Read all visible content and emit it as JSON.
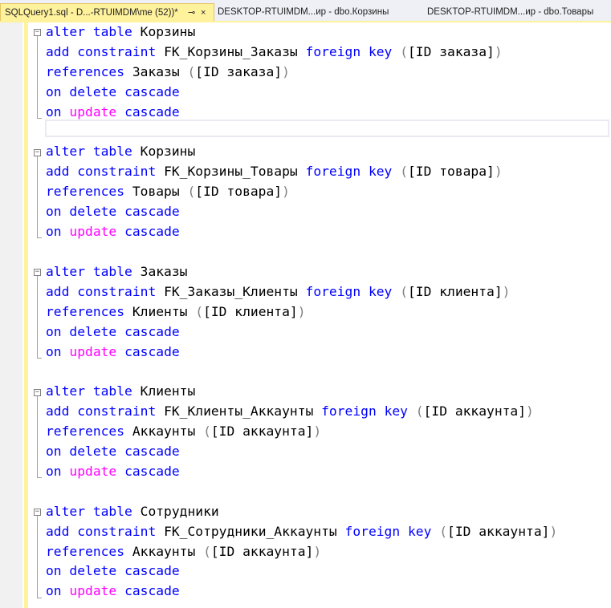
{
  "tabs": [
    {
      "label": "SQLQuery1.sql - D...-RTUIMDM\\me (52))*",
      "active": true,
      "pin_icon": "⊸",
      "close_icon": "×"
    },
    {
      "label": "DESKTOP-RTUIMDM...ир - dbo.Корзины",
      "active": false
    },
    {
      "label": "DESKTOP-RTUIMDM...ир - dbo.Товары",
      "active": false
    }
  ],
  "colors": {
    "keyword": "#0000ff",
    "function_keyword": "#ff00ff",
    "punctuation": "#808080",
    "identifier": "#000000",
    "active_tab": "#fff29d",
    "change_bar": "#fff29d"
  },
  "editor": {
    "blocks": [
      {
        "lines": [
          [
            {
              "t": "alter",
              "c": "kw"
            },
            {
              "t": " "
            },
            {
              "t": "table",
              "c": "kw"
            },
            {
              "t": " Корзины"
            }
          ],
          [
            {
              "t": "add",
              "c": "kw"
            },
            {
              "t": " "
            },
            {
              "t": "constraint",
              "c": "kw"
            },
            {
              "t": " FK_Корзины_Заказы "
            },
            {
              "t": "foreign",
              "c": "kw"
            },
            {
              "t": " "
            },
            {
              "t": "key",
              "c": "kw"
            },
            {
              "t": " "
            },
            {
              "t": "(",
              "c": "gy"
            },
            {
              "t": "[ID заказа]"
            },
            {
              "t": ")",
              "c": "gy"
            }
          ],
          [
            {
              "t": "references",
              "c": "kw"
            },
            {
              "t": " Заказы "
            },
            {
              "t": "(",
              "c": "gy"
            },
            {
              "t": "[ID заказа]"
            },
            {
              "t": ")",
              "c": "gy"
            }
          ],
          [
            {
              "t": "on",
              "c": "kw"
            },
            {
              "t": " "
            },
            {
              "t": "delete",
              "c": "kw"
            },
            {
              "t": " "
            },
            {
              "t": "cascade",
              "c": "kw"
            }
          ],
          [
            {
              "t": "on",
              "c": "kw"
            },
            {
              "t": " "
            },
            {
              "t": "update",
              "c": "pk"
            },
            {
              "t": " "
            },
            {
              "t": "cascade",
              "c": "kw"
            }
          ]
        ]
      },
      {
        "lines": [
          [
            {
              "t": "alter",
              "c": "kw"
            },
            {
              "t": " "
            },
            {
              "t": "table",
              "c": "kw"
            },
            {
              "t": " Корзины"
            }
          ],
          [
            {
              "t": "add",
              "c": "kw"
            },
            {
              "t": " "
            },
            {
              "t": "constraint",
              "c": "kw"
            },
            {
              "t": " FK_Корзины_Товары "
            },
            {
              "t": "foreign",
              "c": "kw"
            },
            {
              "t": " "
            },
            {
              "t": "key",
              "c": "kw"
            },
            {
              "t": " "
            },
            {
              "t": "(",
              "c": "gy"
            },
            {
              "t": "[ID товара]"
            },
            {
              "t": ")",
              "c": "gy"
            }
          ],
          [
            {
              "t": "references",
              "c": "kw"
            },
            {
              "t": " Товары "
            },
            {
              "t": "(",
              "c": "gy"
            },
            {
              "t": "[ID товара]"
            },
            {
              "t": ")",
              "c": "gy"
            }
          ],
          [
            {
              "t": "on",
              "c": "kw"
            },
            {
              "t": " "
            },
            {
              "t": "delete",
              "c": "kw"
            },
            {
              "t": " "
            },
            {
              "t": "cascade",
              "c": "kw"
            }
          ],
          [
            {
              "t": "on",
              "c": "kw"
            },
            {
              "t": " "
            },
            {
              "t": "update",
              "c": "pk"
            },
            {
              "t": " "
            },
            {
              "t": "cascade",
              "c": "kw"
            }
          ]
        ]
      },
      {
        "lines": [
          [
            {
              "t": "alter",
              "c": "kw"
            },
            {
              "t": " "
            },
            {
              "t": "table",
              "c": "kw"
            },
            {
              "t": " Заказы"
            }
          ],
          [
            {
              "t": "add",
              "c": "kw"
            },
            {
              "t": " "
            },
            {
              "t": "constraint",
              "c": "kw"
            },
            {
              "t": " FK_Заказы_Клиенты "
            },
            {
              "t": "foreign",
              "c": "kw"
            },
            {
              "t": " "
            },
            {
              "t": "key",
              "c": "kw"
            },
            {
              "t": " "
            },
            {
              "t": "(",
              "c": "gy"
            },
            {
              "t": "[ID клиента]"
            },
            {
              "t": ")",
              "c": "gy"
            }
          ],
          [
            {
              "t": "references",
              "c": "kw"
            },
            {
              "t": " Клиенты "
            },
            {
              "t": "(",
              "c": "gy"
            },
            {
              "t": "[ID клиента]"
            },
            {
              "t": ")",
              "c": "gy"
            }
          ],
          [
            {
              "t": "on",
              "c": "kw"
            },
            {
              "t": " "
            },
            {
              "t": "delete",
              "c": "kw"
            },
            {
              "t": " "
            },
            {
              "t": "cascade",
              "c": "kw"
            }
          ],
          [
            {
              "t": "on",
              "c": "kw"
            },
            {
              "t": " "
            },
            {
              "t": "update",
              "c": "pk"
            },
            {
              "t": " "
            },
            {
              "t": "cascade",
              "c": "kw"
            }
          ]
        ]
      },
      {
        "lines": [
          [
            {
              "t": "alter",
              "c": "kw"
            },
            {
              "t": " "
            },
            {
              "t": "table",
              "c": "kw"
            },
            {
              "t": " Клиенты"
            }
          ],
          [
            {
              "t": "add",
              "c": "kw"
            },
            {
              "t": " "
            },
            {
              "t": "constraint",
              "c": "kw"
            },
            {
              "t": " FK_Клиенты_Аккаунты "
            },
            {
              "t": "foreign",
              "c": "kw"
            },
            {
              "t": " "
            },
            {
              "t": "key",
              "c": "kw"
            },
            {
              "t": " "
            },
            {
              "t": "(",
              "c": "gy"
            },
            {
              "t": "[ID аккаунта]"
            },
            {
              "t": ")",
              "c": "gy"
            }
          ],
          [
            {
              "t": "references",
              "c": "kw"
            },
            {
              "t": " Аккаунты "
            },
            {
              "t": "(",
              "c": "gy"
            },
            {
              "t": "[ID аккаунта]"
            },
            {
              "t": ")",
              "c": "gy"
            }
          ],
          [
            {
              "t": "on",
              "c": "kw"
            },
            {
              "t": " "
            },
            {
              "t": "delete",
              "c": "kw"
            },
            {
              "t": " "
            },
            {
              "t": "cascade",
              "c": "kw"
            }
          ],
          [
            {
              "t": "on",
              "c": "kw"
            },
            {
              "t": " "
            },
            {
              "t": "update",
              "c": "pk"
            },
            {
              "t": " "
            },
            {
              "t": "cascade",
              "c": "kw"
            }
          ]
        ]
      },
      {
        "lines": [
          [
            {
              "t": "alter",
              "c": "kw"
            },
            {
              "t": " "
            },
            {
              "t": "table",
              "c": "kw"
            },
            {
              "t": " Сотрудники"
            }
          ],
          [
            {
              "t": "add",
              "c": "kw"
            },
            {
              "t": " "
            },
            {
              "t": "constraint",
              "c": "kw"
            },
            {
              "t": " FK_Сотрудники_Аккаунты "
            },
            {
              "t": "foreign",
              "c": "kw"
            },
            {
              "t": " "
            },
            {
              "t": "key",
              "c": "kw"
            },
            {
              "t": " "
            },
            {
              "t": "(",
              "c": "gy"
            },
            {
              "t": "[ID аккаунта]"
            },
            {
              "t": ")",
              "c": "gy"
            }
          ],
          [
            {
              "t": "references",
              "c": "kw"
            },
            {
              "t": " Аккаунты "
            },
            {
              "t": "(",
              "c": "gy"
            },
            {
              "t": "[ID аккаунта]"
            },
            {
              "t": ")",
              "c": "gy"
            }
          ],
          [
            {
              "t": "on",
              "c": "kw"
            },
            {
              "t": " "
            },
            {
              "t": "delete",
              "c": "kw"
            },
            {
              "t": " "
            },
            {
              "t": "cascade",
              "c": "kw"
            }
          ],
          [
            {
              "t": "on",
              "c": "kw"
            },
            {
              "t": " "
            },
            {
              "t": "update",
              "c": "pk"
            },
            {
              "t": " "
            },
            {
              "t": "cascade",
              "c": "kw"
            }
          ]
        ]
      }
    ]
  }
}
